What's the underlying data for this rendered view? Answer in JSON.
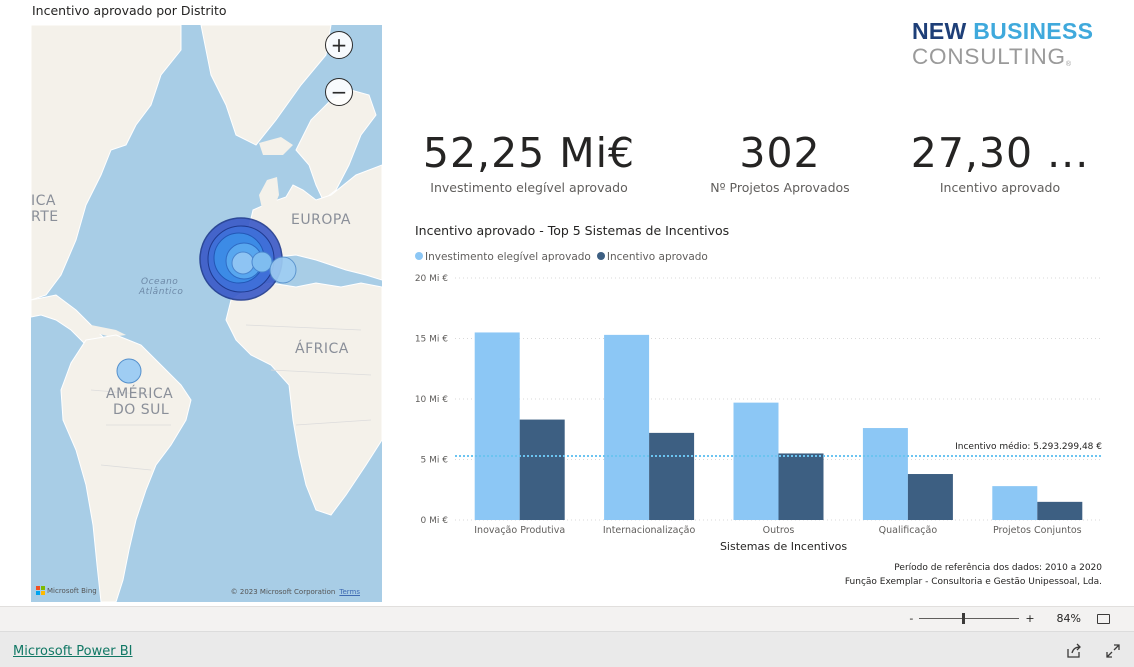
{
  "map": {
    "title": "Incentivo aprovado por Distrito",
    "zoom_in": "+",
    "zoom_out": "−",
    "labels": {
      "america_norte_1": "ICA",
      "america_norte_2": "RTE",
      "europa": "EUROPA",
      "africa": "ÁFRICA",
      "america_sul_1": "AMÉRICA",
      "america_sul_2": "DO SUL",
      "oceano_1": "Oceano",
      "oceano_2": "Atlântico"
    },
    "footer_left": "Microsoft Bing",
    "footer_right": "© 2023 Microsoft Corporation",
    "terms": "Terms"
  },
  "logo": {
    "line1a": "NEW ",
    "line1b": "BUSINESS",
    "line2": "CONSULTING",
    "mark": "®"
  },
  "kpis": [
    {
      "value": "52,25 Mi€",
      "label": "Investimento elegível aprovado"
    },
    {
      "value": "302",
      "label": "Nº Projetos Aprovados"
    },
    {
      "value": "27,30 ...",
      "label": "Incentivo aprovado"
    }
  ],
  "chart_title": "Incentivo aprovado - Top 5 Sistemas de Incentivos",
  "legend": [
    "Investimento elegível aprovado",
    "Incentivo aprovado"
  ],
  "colors": {
    "light": "#8cc7f5",
    "dark": "#3d5f82",
    "avg": "#6cc4f0"
  },
  "chart_data": {
    "type": "bar",
    "categories": [
      "Inovação Produtiva",
      "Internacionalização",
      "Outros",
      "Qualificação",
      "Projetos Conjuntos"
    ],
    "series": [
      {
        "name": "Investimento elegível aprovado",
        "values": [
          15.5,
          15.3,
          9.7,
          7.6,
          2.8
        ]
      },
      {
        "name": "Incentivo aprovado",
        "values": [
          8.3,
          7.2,
          5.5,
          3.8,
          1.5
        ]
      }
    ],
    "xlabel": "Sistemas de Incentivos",
    "ylabel": "",
    "yticks": [
      "0 Mi €",
      "5 Mi €",
      "10 Mi €",
      "15 Mi €",
      "20 Mi €"
    ],
    "ylim": [
      0,
      20
    ],
    "reference_line": {
      "value": 5.29,
      "label": "Incentivo médio: 5.293.299,48 €"
    }
  },
  "footnotes": {
    "ref": "Período de referência dos dados: 2010 a 2020",
    "author": "Função Exemplar - Consultoria e Gestão Unipessoal, Lda."
  },
  "statusbar": {
    "minus": "-",
    "plus": "+",
    "zoom": "84%",
    "zoom_level": 0.44
  },
  "bottombar": {
    "link": "Microsoft Power BI"
  }
}
